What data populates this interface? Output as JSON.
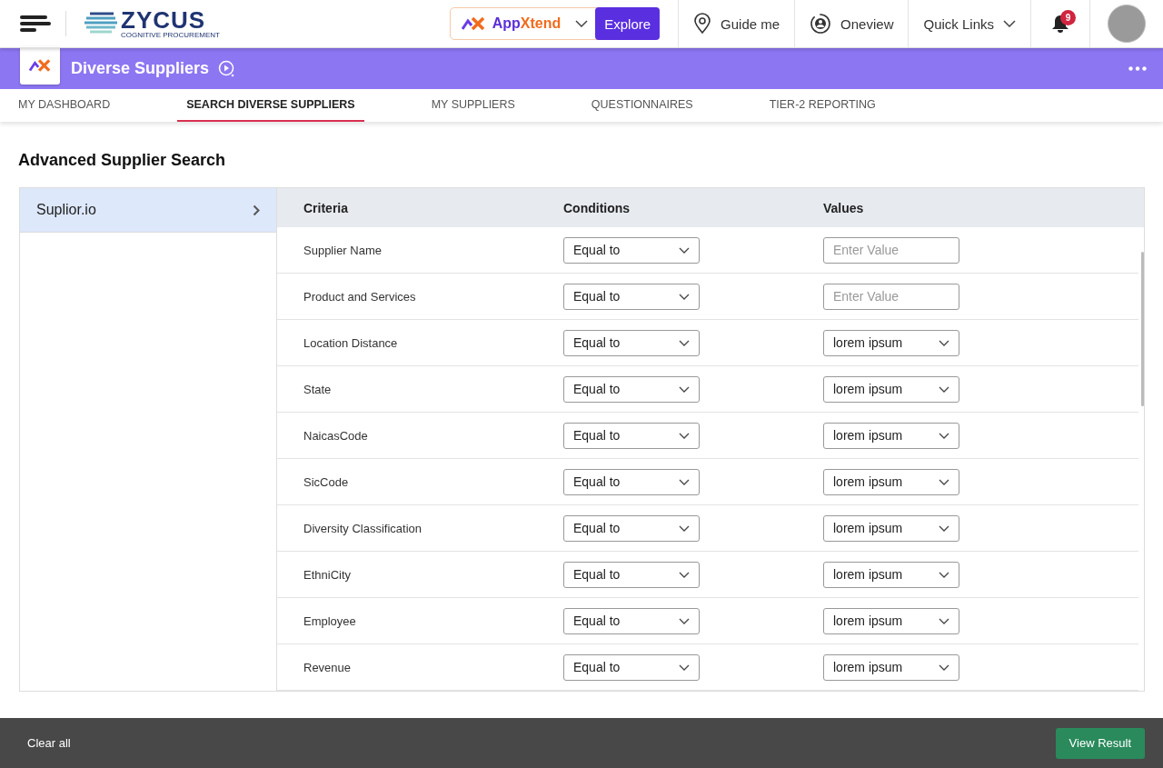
{
  "header": {
    "logo": {
      "name": "ZYCUS",
      "tagline": "COGNITIVE PROCUREMENT"
    },
    "app_switcher": {
      "name_prefix": "App",
      "name_suffix": "Xtend",
      "button": "Explore"
    },
    "links": [
      {
        "label": "Guide me",
        "kind": "guide"
      },
      {
        "label": "Oneview",
        "kind": "oneview"
      },
      {
        "label": "Quick Links",
        "kind": "dropdown"
      }
    ],
    "notifications": {
      "count": "9"
    }
  },
  "app_bar": {
    "title": "Diverse Suppliers"
  },
  "tabs": [
    {
      "label": "MY DASHBOARD",
      "selected": false
    },
    {
      "label": "SEARCH DIVERSE SUPPLIERS",
      "selected": true
    },
    {
      "label": "MY SUPPLIERS",
      "selected": false
    },
    {
      "label": "QUESTIONNAIRES",
      "selected": false
    },
    {
      "label": "TIER-2 REPORTING",
      "selected": false
    }
  ],
  "page_title": "Advanced Supplier Search",
  "sources": [
    {
      "label": "Suplior.io",
      "selected": true
    }
  ],
  "table": {
    "columns": [
      "Criteria",
      "Conditions",
      "Values"
    ],
    "rows": [
      {
        "criteria": "Supplier Name",
        "condition": "Equal to",
        "value": {
          "kind": "input",
          "placeholder": "Enter Value"
        }
      },
      {
        "criteria": "Product and Services",
        "condition": "Equal to",
        "value": {
          "kind": "input",
          "placeholder": "Enter Value"
        }
      },
      {
        "criteria": "Location Distance",
        "condition": "Equal to",
        "value": {
          "kind": "select",
          "text": "lorem ipsum"
        }
      },
      {
        "criteria": "State",
        "condition": "Equal to",
        "value": {
          "kind": "select",
          "text": "lorem ipsum"
        }
      },
      {
        "criteria": "NaicasCode",
        "condition": "Equal to",
        "value": {
          "kind": "select",
          "text": "lorem ipsum"
        }
      },
      {
        "criteria": "SicCode",
        "condition": "Equal to",
        "value": {
          "kind": "select",
          "text": "lorem ipsum"
        }
      },
      {
        "criteria": "Diversity Classification",
        "condition": "Equal to",
        "value": {
          "kind": "select",
          "text": "lorem ipsum"
        }
      },
      {
        "criteria": "EthniCity",
        "condition": "Equal to",
        "value": {
          "kind": "select",
          "text": "lorem ipsum"
        }
      },
      {
        "criteria": "Employee",
        "condition": "Equal to",
        "value": {
          "kind": "select",
          "text": "lorem ipsum"
        }
      },
      {
        "criteria": "Revenue",
        "condition": "Equal to",
        "value": {
          "kind": "select",
          "text": "lorem ipsum"
        }
      }
    ]
  },
  "footer": {
    "clear": "Clear all",
    "submit": "View Result"
  }
}
